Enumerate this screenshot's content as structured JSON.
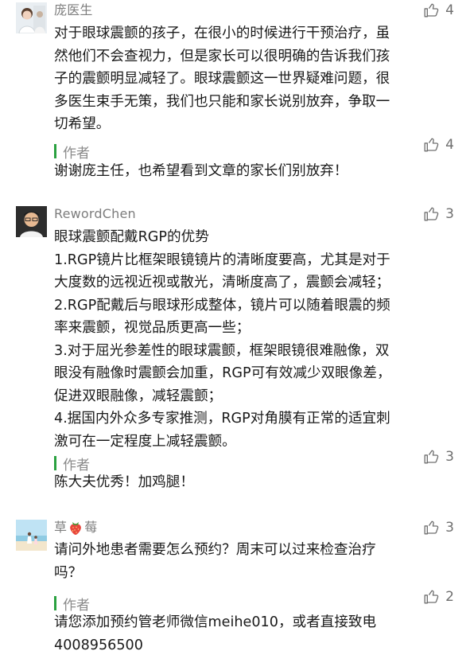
{
  "comments": [
    {
      "user": "庞医生",
      "likes": "4",
      "lines": [
        "对于眼球震颤的孩子，在很小的时候进行干预治疗，虽",
        "然他们不会查视力，但是家长可以很明确的告诉我们孩",
        "子的震颤明显减轻了。眼球震颤这一世界疑难问题，很",
        "多医生束手无策，我们也只能和家长说别放弃，争取一",
        "切希望。"
      ],
      "reply_label": "作者",
      "reply_likes": "4",
      "reply_lines": [
        "谢谢庞主任，也希望看到文章的家长们别放弃！"
      ]
    },
    {
      "user": "RewordChen",
      "likes": "3",
      "lines": [
        "眼球震颤配戴RGP的优势",
        "1.RGP镜片比框架眼镜镜片的清晰度要高，尤其是对于",
        "大度数的远视近视或散光，清晰度高了，震颤会减轻；",
        "2.RGP配戴后与眼球形成整体，镜片可以随着眼震的频",
        "率来震颤，视觉品质更高一些；",
        "3.对于屈光参差性的眼球震颤，框架眼镜很难融像，双",
        "眼没有融像时震颤会加重，RGP可有效减少双眼像差，",
        "促进双眼融像，减轻震颤；",
        "4.据国内外众多专家推测，RGP对角膜有正常的适宜刺",
        "激可在一定程度上减轻震颤。"
      ],
      "reply_label": "作者",
      "reply_likes": "3",
      "reply_lines": [
        "陈大夫优秀！加鸡腿！"
      ]
    },
    {
      "user_prefix": "草",
      "user_suffix": "莓",
      "likes": "3",
      "lines": [
        "请问外地患者需要怎么预约？周末可以过来检查治疗",
        "吗？"
      ],
      "reply_label": "作者",
      "reply_likes": "2",
      "reply_lines": [
        "请您添加预约管老师微信meihe010，或者直接致电",
        "4008956500"
      ]
    }
  ],
  "colors": {
    "reply_bar": "#2aa140",
    "name": "#7d7d7d",
    "text": "#1a1a1a"
  },
  "icons": {
    "like": "thumbs-up-icon",
    "strawberry": "strawberry-emoji"
  }
}
